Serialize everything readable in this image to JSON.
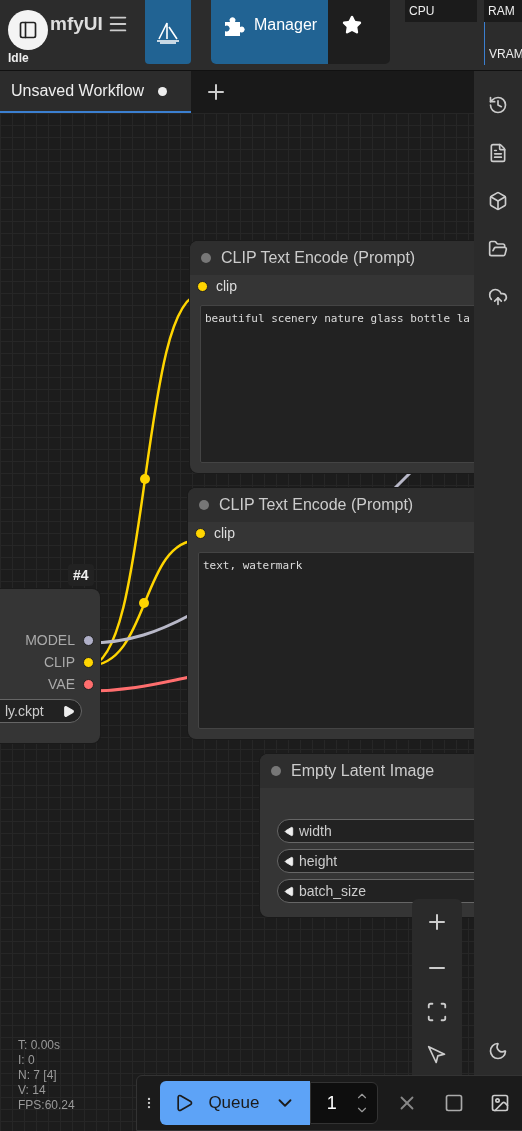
{
  "header": {
    "logo": "mfyUI",
    "status": "Idle",
    "manager_label": "Manager",
    "monitors": [
      {
        "label": "CPU"
      },
      {
        "label": "RAM"
      },
      {
        "label": "VRAM"
      }
    ]
  },
  "tabs": [
    {
      "label": "Unsaved Workflow",
      "selected": true,
      "unsaved": true
    }
  ],
  "nodes": [
    {
      "kind": "prompt",
      "title": "CLIP Text Encode (Prompt)",
      "inputs": [
        {
          "label": "clip",
          "color": "#ffd500"
        }
      ],
      "text": "beautiful scenery nature glass bottle la"
    },
    {
      "kind": "prompt",
      "title": "CLIP Text Encode (Prompt)",
      "inputs": [
        {
          "label": "clip",
          "color": "#ffd500"
        }
      ],
      "text": "text, watermark"
    },
    {
      "kind": "loader",
      "badge": "#4",
      "outputs": [
        {
          "label": "MODEL",
          "color": "#b0b0c8"
        },
        {
          "label": "CLIP",
          "color": "#ffd500"
        },
        {
          "label": "VAE",
          "color": "#ff6e6e"
        }
      ],
      "widget": "ly.ckpt"
    },
    {
      "kind": "latent",
      "title": "Empty Latent Image",
      "widgets": [
        "width",
        "height",
        "batch_size"
      ]
    }
  ],
  "stats": [
    "T: 0.00s",
    "I: 0",
    "N: 7 [4]",
    "V: 14",
    "FPS:60.24"
  ],
  "queue": {
    "label": "Queue",
    "count": "1"
  }
}
